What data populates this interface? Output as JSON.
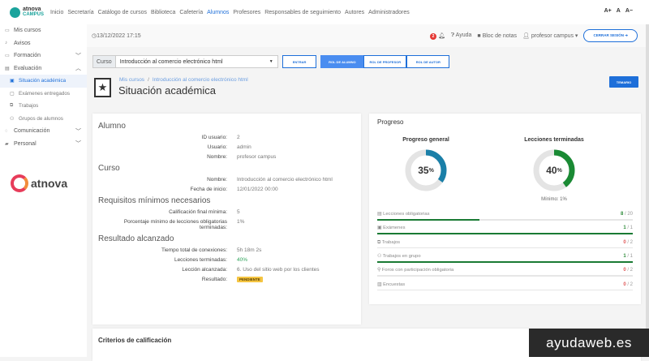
{
  "topnav": {
    "logo_top": "atnova",
    "logo_bottom": "CAMPUS",
    "links": [
      "Inicio",
      "Secretaría",
      "Catálogo de cursos",
      "Biblioteca",
      "Cafetería",
      "Alumnos",
      "Profesores",
      "Responsables de seguimiento",
      "Autores",
      "Administradores"
    ],
    "active": "Alumnos",
    "font_controls": [
      "A+",
      "A",
      "A−"
    ]
  },
  "sidebar": {
    "items": [
      {
        "label": "Mis cursos",
        "icon": "book-icon"
      },
      {
        "label": "Avisos",
        "icon": "bell-icon"
      },
      {
        "label": "Formación",
        "icon": "book-icon"
      },
      {
        "label": "Evaluación",
        "icon": "exam-icon"
      }
    ],
    "subitems": [
      "Situación académica",
      "Exámenes entregados",
      "Trabajos",
      "Grupos de alumnos"
    ],
    "items2": [
      "Comunicación",
      "Personal"
    ],
    "brand": "atnova"
  },
  "header": {
    "datetime": "13/12/2022 17:15",
    "notifications": "2",
    "help": "Ayuda",
    "notes": "Bloc de notas",
    "user": "profesor campus",
    "logout": "CERRAR SESIÓN"
  },
  "course": {
    "label": "Curso",
    "selected": "Introducción al comercio electrónico html",
    "enter": "ENTRAR",
    "roles": [
      "ROL DE ALUMNO",
      "ROL DE PROFESOR",
      "ROL DE AUTOR"
    ],
    "active_role": "ROL DE ALUMNO"
  },
  "page": {
    "breadcrumb": [
      "Mis cursos",
      "Introducción al comercio electrónico html"
    ],
    "title": "Situación académica",
    "temario": "TEMARIO"
  },
  "alumno": {
    "title": "Alumno",
    "rows": [
      [
        "ID usuario:",
        "2"
      ],
      [
        "Usuario:",
        "admin"
      ],
      [
        "Nombre:",
        "profesor campus"
      ]
    ]
  },
  "curso": {
    "title": "Curso",
    "rows": [
      [
        "Nombre:",
        "Introducción al comercio electrónico html"
      ],
      [
        "Fecha de inicio:",
        "12/01/2022 00:00"
      ]
    ]
  },
  "requisitos": {
    "title": "Requisitos mínimos necesarios",
    "rows": [
      [
        "Calificación final mínima:",
        "5"
      ],
      [
        "Porcentaje mínimo de lecciones obligatorias terminadas:",
        "1%"
      ]
    ]
  },
  "resultado": {
    "title": "Resultado alcanzado",
    "rows": [
      [
        "Tiempo total de conexiones:",
        "5h 18m 2s"
      ],
      [
        "Lecciones terminadas:",
        "40%"
      ],
      [
        "Lección alcanzada:",
        "6. Uso del sitio web por los clientes"
      ]
    ],
    "result_label": "Resultado:",
    "result_value": "PENDIENTE"
  },
  "progreso": {
    "title": "Progreso",
    "gauges": [
      {
        "label": "Progreso general",
        "value": 35,
        "color": "#1a7fa8"
      },
      {
        "label": "Lecciones terminadas",
        "value": 40,
        "color": "#1a8a34",
        "note": "Mínimo: 1%"
      }
    ],
    "items": [
      {
        "label": "Lecciones obligatorias",
        "done": "8",
        "total": "/ 20",
        "ratio": 0.4
      },
      {
        "label": "Exámenes",
        "done": "1",
        "total": "/ 1",
        "ratio": 1
      },
      {
        "label": "Trabajos",
        "done": "0",
        "total": "/ 2",
        "ratio": 0
      },
      {
        "label": "Trabajos en grupo",
        "done": "1",
        "total": "/ 1",
        "ratio": 1
      },
      {
        "label": "Foros con participación obligatoria",
        "done": "0",
        "total": "/ 2",
        "ratio": 0
      },
      {
        "label": "Encuestas",
        "done": "0",
        "total": "/ 2",
        "ratio": 0
      }
    ]
  },
  "criterios": {
    "title": "Criterios de calificación"
  },
  "watermark": "ayudaweb.es"
}
